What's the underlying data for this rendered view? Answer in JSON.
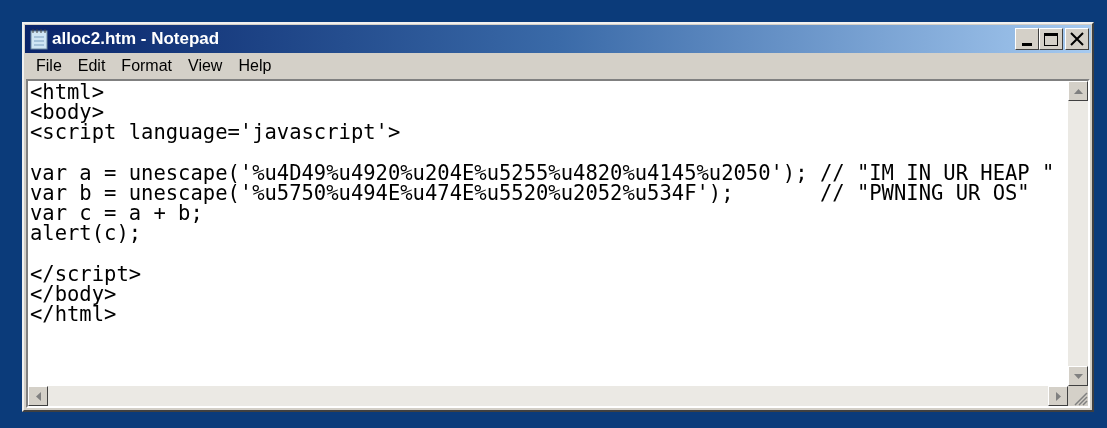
{
  "window": {
    "title": "alloc2.htm - Notepad"
  },
  "menu": [
    "File",
    "Edit",
    "Format",
    "View",
    "Help"
  ],
  "editor": {
    "text": "<html>\n<body>\n<script language='javascript'>\n\nvar a = unescape('%u4D49%u4920%u204E%u5255%u4820%u4145%u2050'); // \"IM IN UR HEAP \"\nvar b = unescape('%u5750%u494E%u474E%u5520%u2052%u534F');       // \"PWNING UR OS\"\nvar c = a + b;\nalert(c);\n\n</script>\n</body>\n</html>"
  }
}
